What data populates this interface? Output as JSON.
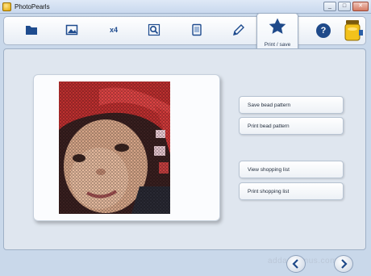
{
  "window": {
    "title": "PhotoPearls",
    "buttons": [
      "_",
      "□",
      "✕"
    ]
  },
  "toolbar": {
    "tools": [
      {
        "name": "folder-icon"
      },
      {
        "name": "image-icon"
      },
      {
        "name": "x4",
        "text": "x4"
      },
      {
        "name": "magnifier-icon"
      },
      {
        "name": "document-icon"
      },
      {
        "name": "pencil-icon"
      }
    ],
    "active": {
      "icon": "star-icon",
      "label": "Print / save"
    },
    "help": "?"
  },
  "actions": {
    "save_pattern": "Save bead pattern",
    "print_pattern": "Print bead pattern",
    "view_list": "View shopping list",
    "print_list": "Print shopping list"
  },
  "watermark": "addappymus.com",
  "colors": {
    "accent": "#1f4a8a",
    "background": "#c9d8ea",
    "panel": "#dfe6ef"
  }
}
